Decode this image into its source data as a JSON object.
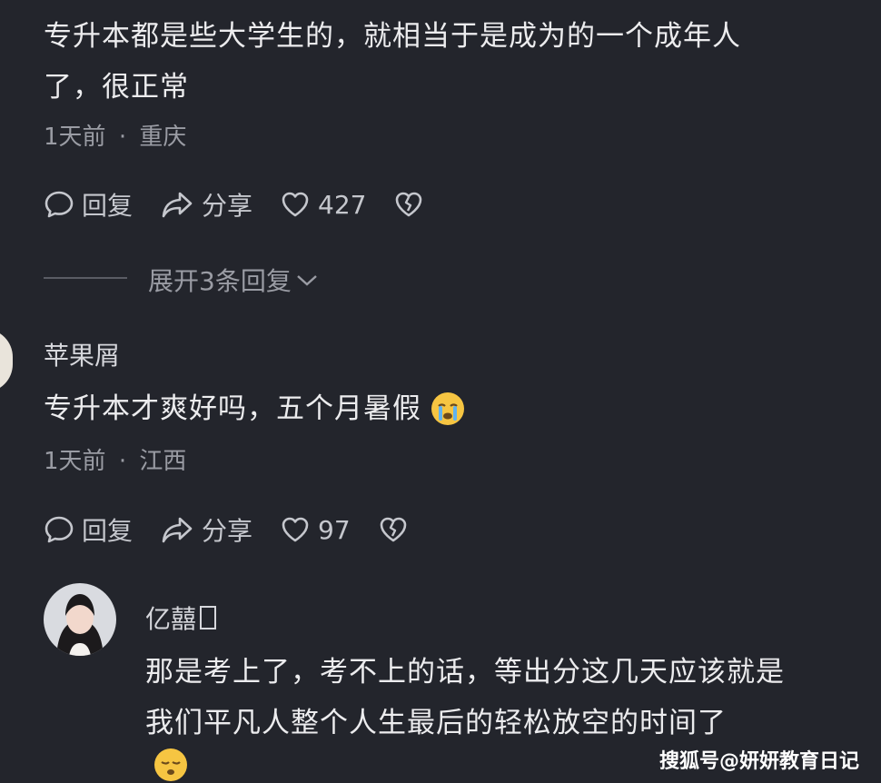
{
  "comment1": {
    "text_line1": "专升本都是些大学生的，就相当于是成为的一个成年人",
    "text_line2": "了，很正常",
    "time": "1天前",
    "location": "重庆",
    "reply_label": "回复",
    "share_label": "分享",
    "likes": "427"
  },
  "expand": {
    "label": "展开3条回复"
  },
  "comment2": {
    "username": "苹果屑",
    "text": "专升本才爽好吗，五个月暑假",
    "emoji": "crying-face",
    "time": "1天前",
    "location": "江西",
    "reply_label": "回复",
    "share_label": "分享",
    "likes": "97"
  },
  "comment3": {
    "username": "亿囍",
    "text_line1": "那是考上了，考不上的话，等出分这几天应该就是",
    "text_line2": "我们平凡人整个人生最后的轻松放空的时间了",
    "emoji": "relieved-face"
  },
  "watermark": "搜狐号@妍妍教育日记",
  "meta_separator": "·",
  "colors": {
    "background": "#23252c",
    "text": "#ececee",
    "meta": "#9a9ca4"
  }
}
